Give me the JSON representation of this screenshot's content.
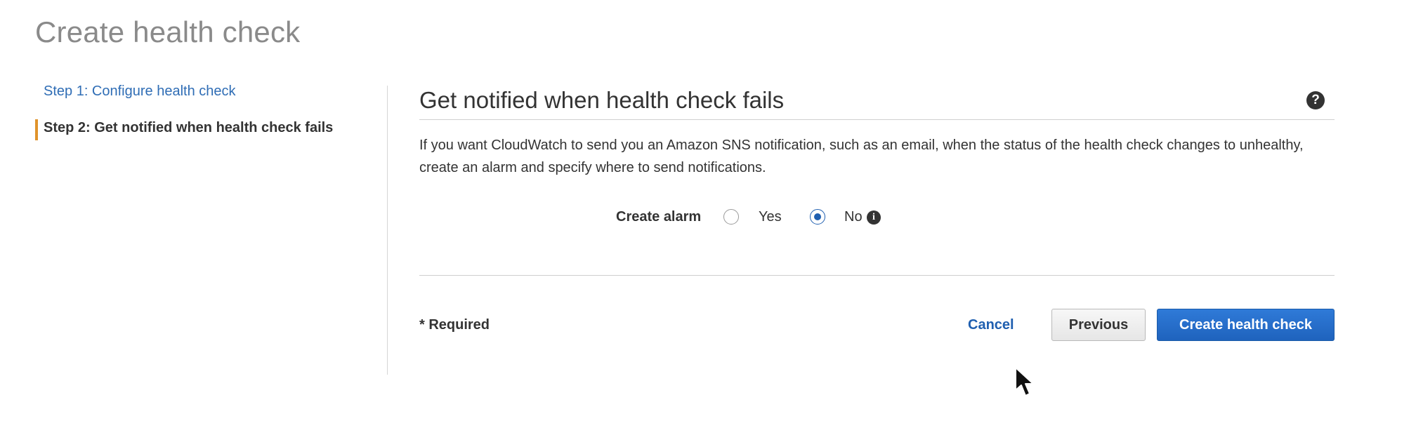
{
  "page": {
    "title": "Create health check"
  },
  "steps": [
    {
      "label": "Step 1: Configure health check",
      "state": "link"
    },
    {
      "label": "Step 2: Get notified when health check fails",
      "state": "current"
    }
  ],
  "section": {
    "title": "Get notified when health check fails",
    "help_icon": "question-circle",
    "description": "If you want CloudWatch to send you an Amazon SNS notification, such as an email, when the status of the health check changes to unhealthy, create an alarm and specify where to send notifications."
  },
  "alarm": {
    "label": "Create alarm",
    "options": [
      {
        "label": "Yes",
        "selected": false
      },
      {
        "label": "No",
        "selected": true
      }
    ],
    "info_icon": "info-circle"
  },
  "footer": {
    "required_note": "* Required",
    "cancel_label": "Cancel",
    "previous_label": "Previous",
    "submit_label": "Create health check"
  },
  "colors": {
    "link": "#2f6db5",
    "step_marker": "#e0932c",
    "primary_button": "#1f63bd",
    "radio_selected": "#1f5fb0"
  }
}
